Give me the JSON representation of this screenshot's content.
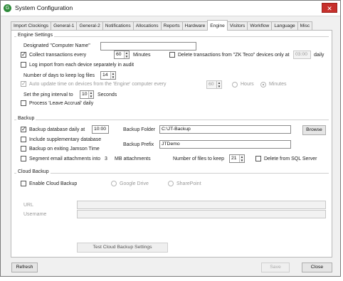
{
  "window": {
    "title": "System Configuration",
    "close_glyph": "✕",
    "app_icon": "G"
  },
  "tabs": [
    "Import Clockings",
    "General-1",
    "General-2",
    "Notifications",
    "Allocations",
    "Reports",
    "Hardware",
    "Engine",
    "Visitors",
    "Workflow",
    "Language",
    "Misc"
  ],
  "active_tab": "Engine",
  "engine": {
    "group_title": "Engine Settings",
    "computer_name_label": "Designated \"Computer Name\"",
    "computer_name_value": "",
    "collect_label": "Collect transactions every",
    "collect_value": "60",
    "collect_unit": "Minutes",
    "collect_checked": true,
    "delete_zk_label": "Delete transactions from \"ZK Teco\" devices only at",
    "delete_zk_time": "03:00",
    "delete_zk_suffix": "daily",
    "delete_zk_checked": false,
    "log_import_label": "Log import from each device separately in audit",
    "log_import_checked": false,
    "days_keep_label": "Number of days to keep log files",
    "days_keep_value": "14",
    "auto_update_label": "Auto update time on devices from the 'Engine' computer every",
    "auto_update_value": "60",
    "auto_update_checked": true,
    "hours_label": "Hours",
    "minutes_label": "Minutes",
    "ping_label": "Set the ping interval to",
    "ping_value": "10",
    "ping_unit": "Seconds",
    "leave_accrual_label": "Process 'Leave Accrual' daily",
    "leave_accrual_checked": false
  },
  "backup": {
    "group_title": "Backup",
    "daily_label": "Backup database daily at",
    "daily_checked": true,
    "daily_time": "10:00",
    "folder_label": "Backup Folder",
    "folder_value": "C:\\JT-Backup",
    "browse_label": "Browse",
    "supplementary_label": "Include supplementary database",
    "supplementary_checked": false,
    "prefix_label": "Backup Prefix",
    "prefix_value": "JTDemo",
    "exiting_label": "Backup on exiting Jamson Time",
    "exiting_checked": false,
    "segment_label": "Segment email attachments into",
    "segment_value": "3",
    "segment_unit": "MB attachments",
    "segment_checked": false,
    "files_keep_label": "Number of files to keep",
    "files_keep_value": "21",
    "delete_sql_label": "Delete from SQL Server",
    "delete_sql_checked": false
  },
  "cloud": {
    "group_title": "Cloud Backup",
    "enable_label": "Enable Cloud Backup",
    "enable_checked": false,
    "google_label": "Google Drive",
    "sharepoint_label": "SharePoint",
    "url_label": "URL",
    "url_value": "",
    "username_label": "Username",
    "username_value": "",
    "test_button_label": "Test Cloud Backup Settings"
  },
  "footer": {
    "refresh_label": "Refresh",
    "save_label": "Save",
    "close_label": "Close"
  },
  "check_glyph": "✓"
}
